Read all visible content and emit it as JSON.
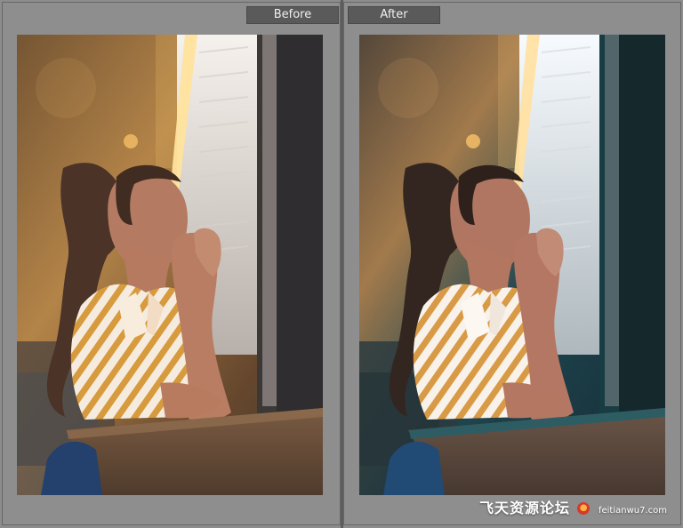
{
  "comparison": {
    "before_label": "Before",
    "after_label": "After"
  },
  "watermark": {
    "brand": "飞天资源论坛",
    "domain": "feitianwu7.com"
  },
  "colors": {
    "before_accent": "#d8a45d",
    "after_accent": "#1d4b57"
  }
}
